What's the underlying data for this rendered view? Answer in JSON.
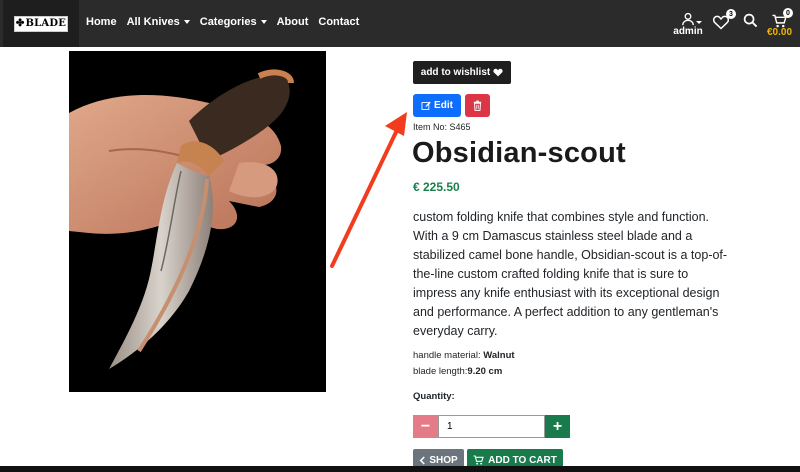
{
  "nav": {
    "brand": "BLADE",
    "links": [
      "Home",
      "All Knives",
      "Categories",
      "About",
      "Contact"
    ],
    "user_name": "admin",
    "wishlist_count": "3",
    "cart_count": "0",
    "cart_total": "€0.00"
  },
  "product": {
    "wishlist_label": "add to wishlist",
    "edit_label": "Edit",
    "item_no": "Item No: S465",
    "title": "Obsidian-scout",
    "price": "€ 225.50",
    "description": "custom folding knife that combines style and function. With a 9 cm Damascus stainless steel blade and a stabilized camel bone handle, Obsidian-scout is a top-of-the-line custom crafted folding knife that is sure to impress any knife enthusiast with its exceptional design and performance. A perfect addition to any gentleman's everyday carry.",
    "spec_handle_label": "handle material: ",
    "spec_handle_value": "Walnut",
    "spec_blade_label": "blade length:",
    "spec_blade_value": "9.20 cm",
    "quantity_label": "Quantity:",
    "quantity_value": "1",
    "minus": "−",
    "plus": "+",
    "shop_label": "SHOP",
    "add_to_cart_label": "ADD TO CART"
  },
  "colors": {
    "navbar": "#2b2b2b",
    "primary": "#0d6efd",
    "danger": "#dc3545",
    "success": "#197a4c",
    "cart_total": "#f0b400",
    "annotation_arrow": "#f23c1e"
  },
  "icons": [
    "user-icon",
    "heart-icon",
    "search-icon",
    "cart-icon",
    "pencil-icon",
    "trash-icon",
    "chevron-left-icon"
  ]
}
